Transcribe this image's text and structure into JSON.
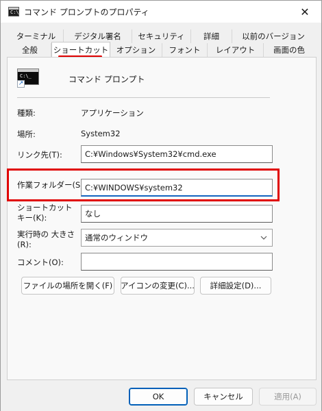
{
  "window": {
    "title": "コマンド プロンプトのプロパティ",
    "close_glyph": "✕",
    "icon_prompt": "C:\\_"
  },
  "tabs": {
    "row1": [
      "ターミナル",
      "デジタル署名",
      "セキュリティ",
      "詳細",
      "以前のバージョン"
    ],
    "row2": [
      "全般",
      "ショートカット",
      "オプション",
      "フォント",
      "レイアウト",
      "画面の色"
    ],
    "active": "ショートカット"
  },
  "app": {
    "name": "コマンド プロンプト",
    "icon_prompt": "C:\\_",
    "overlay_glyph": "↗"
  },
  "fields": {
    "type_label": "種類:",
    "type_value": "アプリケーション",
    "location_label": "場所:",
    "location_value": "System32",
    "target_label": "リンク先(T):",
    "target_value": "C:¥Windows¥System32¥cmd.exe",
    "startin_label": "作業フォルダー(S):",
    "startin_value": "C:¥WINDOWS¥system32",
    "hotkey_label": "ショートカット キー(K):",
    "hotkey_value": "なし",
    "run_label": "実行時の 大きさ(R):",
    "run_value": "通常のウィンドウ",
    "comment_label": "コメント(O):",
    "comment_value": ""
  },
  "buttons": {
    "open_location": "ファイルの場所を開く(F)",
    "change_icon": "アイコンの変更(C)...",
    "advanced": "詳細設定(D)...",
    "ok": "OK",
    "cancel": "キャンセル",
    "apply": "適用(A)"
  },
  "colors": {
    "highlight": "#e00000",
    "focus_accent": "#1565c0"
  }
}
